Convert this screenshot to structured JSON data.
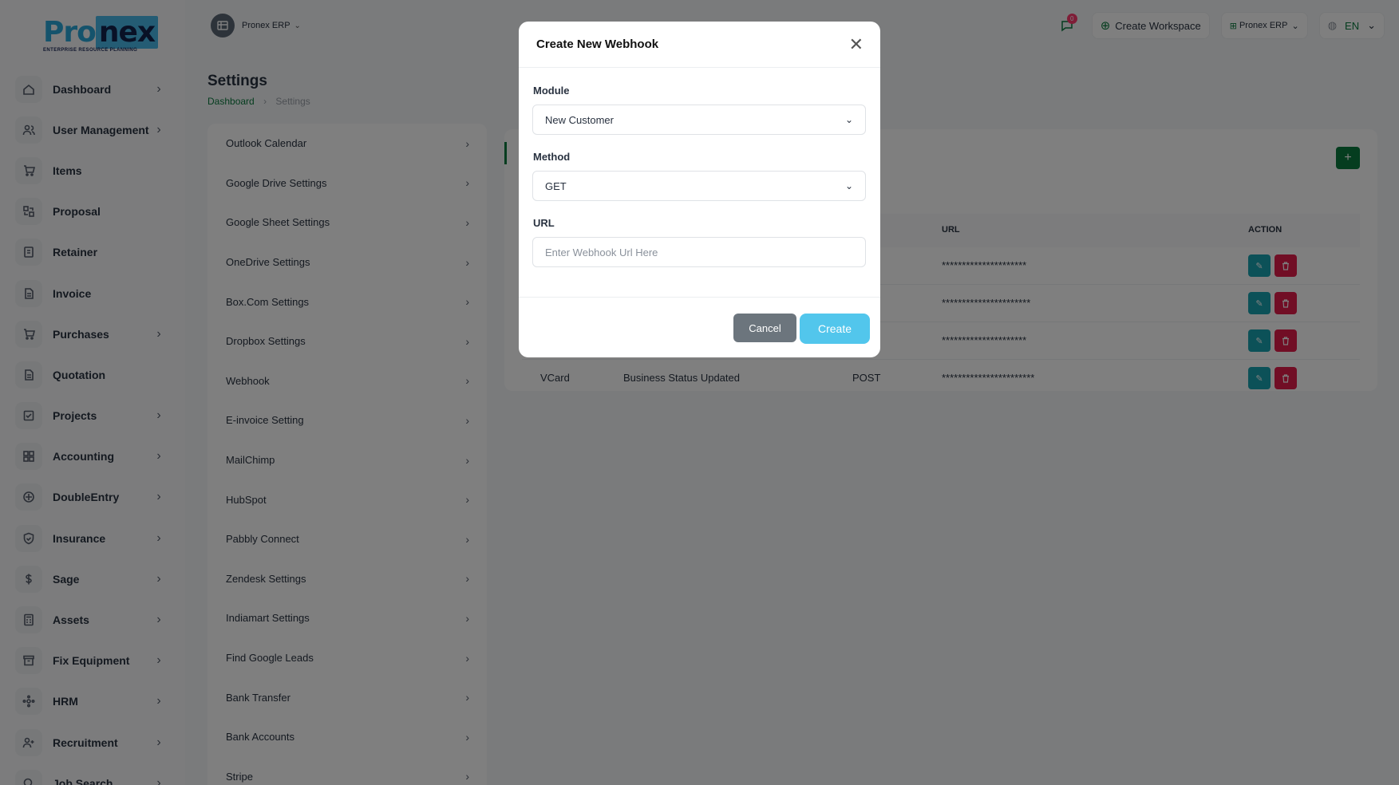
{
  "brand": {
    "logo_pr": "Pro",
    "logo_nex": "nex",
    "tagline": "ENTERPRISE RESOURCE PLANNING"
  },
  "topbar": {
    "workspace": "Pronex ERP",
    "notification_count": "0",
    "create_workspace": "Create Workspace",
    "erp_switch": "Pronex ERP",
    "language": "EN"
  },
  "sidebar": {
    "items": [
      {
        "label": "Dashboard",
        "icon": "home-icon",
        "has_children": true
      },
      {
        "label": "User Management",
        "icon": "users-icon",
        "has_children": true
      },
      {
        "label": "Items",
        "icon": "cart-icon",
        "has_children": false
      },
      {
        "label": "Proposal",
        "icon": "proposal-icon",
        "has_children": false
      },
      {
        "label": "Retainer",
        "icon": "retainer-icon",
        "has_children": false
      },
      {
        "label": "Invoice",
        "icon": "file-icon",
        "has_children": false
      },
      {
        "label": "Purchases",
        "icon": "cart-icon",
        "has_children": true
      },
      {
        "label": "Quotation",
        "icon": "file-icon",
        "has_children": false
      },
      {
        "label": "Projects",
        "icon": "check-square-icon",
        "has_children": true
      },
      {
        "label": "Accounting",
        "icon": "grid-icon",
        "has_children": true
      },
      {
        "label": "DoubleEntry",
        "icon": "scale-icon",
        "has_children": true
      },
      {
        "label": "Insurance",
        "icon": "shield-icon",
        "has_children": true
      },
      {
        "label": "Sage",
        "icon": "dollar-icon",
        "has_children": true
      },
      {
        "label": "Assets",
        "icon": "calculator-icon",
        "has_children": true
      },
      {
        "label": "Fix Equipment",
        "icon": "archive-icon",
        "has_children": true
      },
      {
        "label": "HRM",
        "icon": "network-icon",
        "has_children": true
      },
      {
        "label": "Recruitment",
        "icon": "user-plus-icon",
        "has_children": true
      },
      {
        "label": "Job Search",
        "icon": "search-icon",
        "has_children": true
      }
    ]
  },
  "page": {
    "title": "Settings",
    "breadcrumb": [
      "Dashboard",
      "Settings"
    ]
  },
  "settings_menu": [
    "Outlook Calendar",
    "Google Drive Settings",
    "Google Sheet Settings",
    "OneDrive Settings",
    "Box.Com Settings",
    "Dropbox Settings",
    "Webhook",
    "E-invoice Setting",
    "MailChimp",
    "HubSpot",
    "Pabbly Connect",
    "Zendesk Settings",
    "Indiamart Settings",
    "Find Google Leads",
    "Bank Transfer",
    "Bank Accounts",
    "Stripe"
  ],
  "webhook_table": {
    "headers": {
      "method": "OD",
      "url": "URL",
      "action": "ACTION"
    },
    "rows": [
      {
        "module": "",
        "action_name": "",
        "method": "",
        "url": "*********************"
      },
      {
        "module": "",
        "action_name": "",
        "method": "",
        "url": "**********************"
      },
      {
        "module": "",
        "action_name": "",
        "method": "",
        "url": "*********************"
      },
      {
        "module": "VCard",
        "action_name": "Business Status Updated",
        "method": "POST",
        "url": "***********************"
      }
    ],
    "add_label": "+"
  },
  "modal": {
    "title": "Create New Webhook",
    "module_label": "Module",
    "module_value": "New Customer",
    "method_label": "Method",
    "method_value": "GET",
    "url_label": "URL",
    "url_placeholder": "Enter Webhook Url Here",
    "cancel_label": "Cancel",
    "create_label": "Create"
  },
  "colors": {
    "accent": "#0b7a3e",
    "create_button": "#52c6ec",
    "cancel_button": "#6c757d",
    "edit": "#18a3b1",
    "delete": "#e21d4a"
  }
}
